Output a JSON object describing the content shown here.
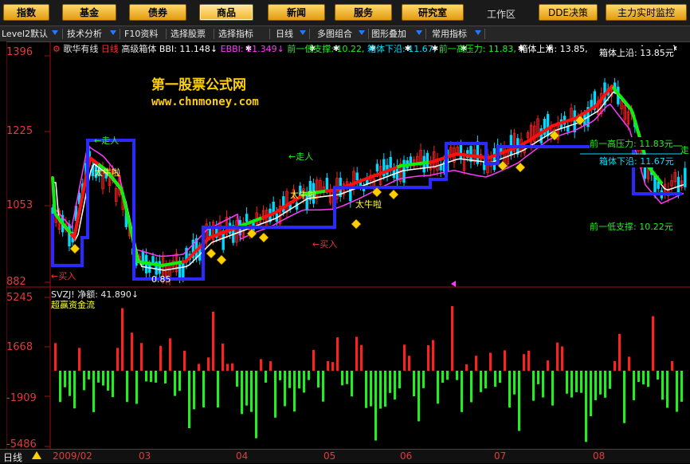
{
  "top_buttons": [
    "指数",
    "基金",
    "债券",
    "商品",
    "新闻",
    "服务",
    "研究室",
    "DDE决策",
    "主力实时监控"
  ],
  "workarea_label": "工作区",
  "toolbar": {
    "items": [
      "Level2默认",
      "技术分析",
      "F10资料",
      "选择股票",
      "选择指标",
      "日线",
      "多图组合",
      "图形叠加",
      "常用指标"
    ]
  },
  "main_chart": {
    "stock_name": "歌华有线",
    "period": "日线",
    "indicator": "高级箱体",
    "bbi": "BBI: 11.148↓",
    "ebbi": "EBBI: 11.349↓",
    "prev_low_support": "前一低支撑: 10.22,",
    "box_lower": "箱体下沿: 11.67,",
    "prev_high_pressure": "前一高压力: 11.83,",
    "box_upper": "箱体上沿: 13.85,",
    "y_ticks": [
      "1396",
      "1225",
      "1053",
      "882"
    ],
    "annotations": {
      "walk1": "←走人",
      "bull1": "太牛啦",
      "buy1": "←买入",
      "bull2": "太牛啦",
      "walk2": "←走人",
      "bull3": "太牛啦",
      "buy2": "←买入",
      "box_top": "箱体上沿: 13.85元",
      "prev_high": "前一高压力: 11.83元",
      "box_bottom": "箱体下沿: 11.67元",
      "prev_low": "前一低支撑: 10.22元",
      "walk3": "走",
      "low_val": "0.85"
    },
    "colors": {
      "up": "#ff2020",
      "down": "#00d8ff",
      "box": "#2a2aff",
      "bbi": "#ffffff",
      "ebbi": "#ff3aff",
      "trend_up": "#ff1010",
      "trend_down": "#10ee10"
    }
  },
  "watermark": {
    "line1": "第一股票公式网",
    "line2": "www.chnmoney.com"
  },
  "sub_chart": {
    "title": "SVZJ! 净额: 41.890↓",
    "subtitle": "超赢资金流",
    "y_ticks": [
      "5245",
      "1668",
      "-1909",
      "-5486"
    ],
    "colors": {
      "pos": "#ff2020",
      "neg": "#22ee22"
    }
  },
  "bottom": {
    "period_label": "日线",
    "dates": [
      "2009/02",
      "03",
      "04",
      "05",
      "06",
      "07",
      "08"
    ]
  }
}
